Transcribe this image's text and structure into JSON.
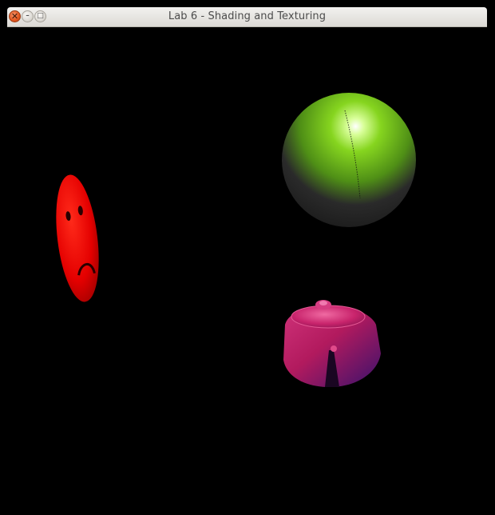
{
  "window": {
    "title": "Lab 6 - Shading and Texturing",
    "controls": {
      "close_glyph": "✕",
      "minimize_glyph": "–",
      "maximize_glyph": "□"
    }
  },
  "scene": {
    "background_color": "#000000",
    "objects": {
      "sphere_color": "#7ed321",
      "face_color": "#e60000",
      "teapot_color": "#b0185a"
    }
  }
}
